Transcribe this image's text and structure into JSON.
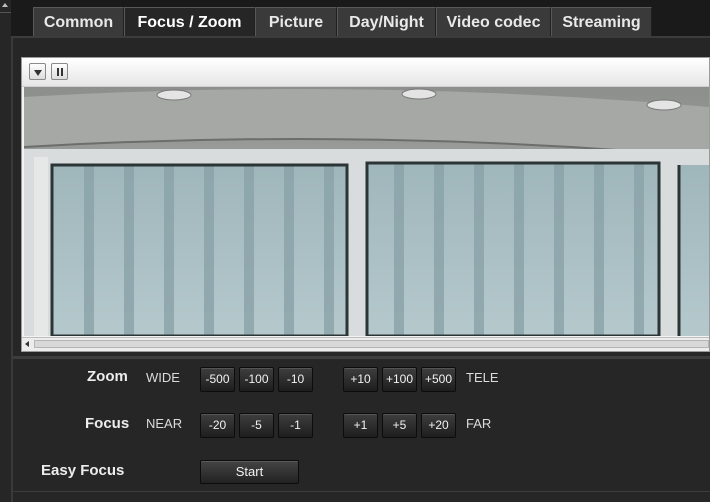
{
  "tabs": [
    {
      "label": "Common",
      "active": false
    },
    {
      "label": "Focus / Zoom",
      "active": true
    },
    {
      "label": "Picture",
      "active": false
    },
    {
      "label": "Day/Night",
      "active": false
    },
    {
      "label": "Video codec",
      "active": false
    },
    {
      "label": "Streaming",
      "active": false
    }
  ],
  "viewer": {
    "toolbar_buttons": [
      "dropdown-icon",
      "pause-icon"
    ]
  },
  "zoom": {
    "label": "Zoom",
    "left_label": "WIDE",
    "right_label": "TELE",
    "minus_buttons": [
      "-500",
      "-100",
      "-10"
    ],
    "plus_buttons": [
      "+10",
      "+100",
      "+500"
    ]
  },
  "focus": {
    "label": "Focus",
    "left_label": "NEAR",
    "right_label": "FAR",
    "minus_buttons": [
      "-20",
      "-5",
      "-1"
    ],
    "plus_buttons": [
      "+1",
      "+5",
      "+20"
    ]
  },
  "easy_focus": {
    "label": "Easy Focus",
    "button": "Start"
  },
  "colors": {
    "background": "#262626",
    "tab": "#3a3a3a",
    "viewer_toolbar": "#f2f2f2"
  }
}
